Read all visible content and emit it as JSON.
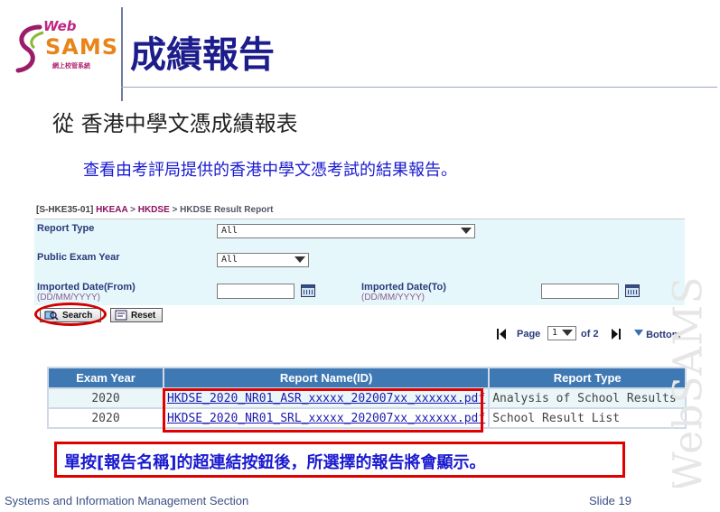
{
  "header": {
    "logo_web": "Web",
    "logo_sams": "SAMS",
    "logo_sub": "網上校管系統",
    "title": "成績報告",
    "subtitle": "從 香港中學文憑成績報表",
    "description": "查看由考評局提供的香港中學文憑考試的結果報告。"
  },
  "screen": {
    "breadcrumb": {
      "code": "[S-HKE35-01]",
      "level1": "HKEAA",
      "sep": ">",
      "level2": "HKDSE",
      "current": "HKDSE Result Report"
    },
    "form": {
      "report_type_label": "Report Type",
      "report_type_value": "All",
      "exam_year_label": "Public Exam Year",
      "exam_year_value": "All",
      "date_from_label": "Imported Date(From)",
      "date_from_hint": "(DD/MM/YYYY)",
      "date_to_label": "Imported Date(To)",
      "date_to_hint": "(DD/MM/YYYY)",
      "search_label": "Search",
      "reset_label": "Reset"
    },
    "pager": {
      "page_label": "Page",
      "page_value": "1",
      "of_label": "of 2",
      "bottom_label": "Bottom"
    },
    "table": {
      "headers": [
        "Exam Year",
        "Report Name(ID)",
        "Report Type"
      ],
      "rows": [
        [
          "2020",
          "HKDSE_2020_NR01_ASR_xxxxx_202007xx_xxxxxx.pdf",
          "Analysis of School Results"
        ],
        [
          "2020",
          "HKDSE_2020_NR01_SRL_xxxxx_202007xx_xxxxxx.pdf",
          "School Result List"
        ]
      ]
    }
  },
  "note": "單按[報告名稱]的超連結按鈕後，所選擇的報告將會顯示。",
  "footer": {
    "left": "Systems and Information Management Section",
    "slide": "Slide 19"
  },
  "watermark": "WebSAMS",
  "colors": {
    "title": "#1c1c8c",
    "link": "#1a1ad0",
    "table_header": "#3f79b4",
    "highlight": "#e00000",
    "form_bg": "#e6f7fb"
  },
  "icons": [
    "websams-logo-icon",
    "search-icon",
    "reset-icon",
    "calendar-icon",
    "first-page-icon",
    "last-page-icon",
    "bottom-arrow-icon"
  ]
}
